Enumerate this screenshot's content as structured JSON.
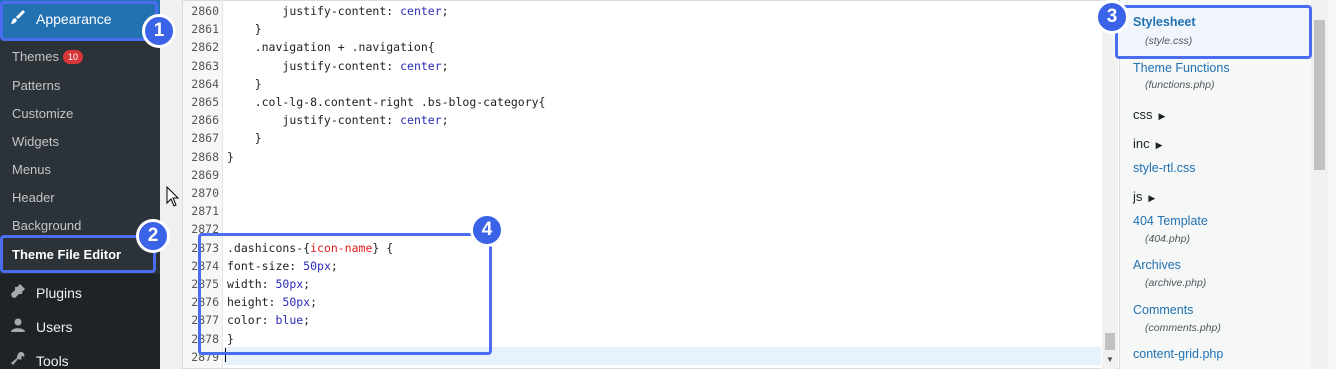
{
  "sidebar": {
    "appearance_label": "Appearance",
    "submenu": [
      {
        "label": "Themes",
        "badge": "10"
      },
      {
        "label": "Patterns"
      },
      {
        "label": "Customize"
      },
      {
        "label": "Widgets"
      },
      {
        "label": "Menus"
      },
      {
        "label": "Header"
      },
      {
        "label": "Background"
      },
      {
        "label": "Theme File Editor"
      }
    ],
    "menu": [
      {
        "label": "Plugins",
        "icon": "plugin-icon"
      },
      {
        "label": "Users",
        "icon": "user-icon"
      },
      {
        "label": "Tools",
        "icon": "wrench-icon"
      }
    ]
  },
  "editor": {
    "lines": [
      {
        "num": "2860",
        "indent": "        ",
        "prop": "justify-content:",
        "val": " center",
        "suffix": ";"
      },
      {
        "num": "2861",
        "text": "    }"
      },
      {
        "num": "2862",
        "text": "    .navigation + .navigation{"
      },
      {
        "num": "2863",
        "indent": "        ",
        "prop": "justify-content:",
        "val": " center",
        "suffix": ";"
      },
      {
        "num": "2864",
        "text": "    }"
      },
      {
        "num": "2865",
        "text": "    .col-lg-8.content-right .bs-blog-category{"
      },
      {
        "num": "2866",
        "indent": "        ",
        "prop": "justify-content:",
        "val": " center",
        "suffix": ";"
      },
      {
        "num": "2867",
        "text": "    }"
      },
      {
        "num": "2868",
        "text": "}"
      },
      {
        "num": "2869",
        "text": ""
      },
      {
        "num": "2870",
        "text": ""
      },
      {
        "num": "2871",
        "text": ""
      },
      {
        "num": "2872",
        "text": ""
      },
      {
        "num": "2873",
        "sel_pre": ".dashicons-{",
        "sel_red": "icon-name",
        "sel_post": "} {"
      },
      {
        "num": "2874",
        "indent": "",
        "prop": "font-size:",
        "val": " 50px",
        "suffix": ";"
      },
      {
        "num": "2875",
        "indent": "",
        "prop": "width:",
        "val": " 50px",
        "suffix": ";"
      },
      {
        "num": "2876",
        "indent": "",
        "prop": "height:",
        "val": " 50px",
        "suffix": ";"
      },
      {
        "num": "2877",
        "indent": "",
        "prop": "color:",
        "val": " blue",
        "suffix": ";"
      },
      {
        "num": "2878",
        "text": "}"
      },
      {
        "num": "2879",
        "text": ""
      }
    ]
  },
  "files": {
    "items": [
      {
        "type": "file",
        "label": "Stylesheet",
        "sub": "(style.css)",
        "current": true
      },
      {
        "type": "file",
        "label": "Theme Functions",
        "sub": "(functions.php)"
      },
      {
        "type": "dir",
        "label": "css"
      },
      {
        "type": "dir",
        "label": "inc"
      },
      {
        "type": "file",
        "label": "style-rtl.css"
      },
      {
        "type": "dir",
        "label": "js"
      },
      {
        "type": "file",
        "label": "404 Template",
        "sub": "(404.php)"
      },
      {
        "type": "file",
        "label": "Archives",
        "sub": "(archive.php)"
      },
      {
        "type": "file",
        "label": "Comments",
        "sub": "(comments.php)"
      },
      {
        "type": "file",
        "label": "content-grid.php"
      }
    ]
  },
  "annotations": {
    "markers": [
      "1",
      "2",
      "3",
      "4"
    ],
    "color": "#3a63e8"
  },
  "colors": {
    "sidebar_bg": "#1d2327",
    "submenu_bg": "#2c3338",
    "active_menu": "#2271b1",
    "link": "#2271b1"
  }
}
